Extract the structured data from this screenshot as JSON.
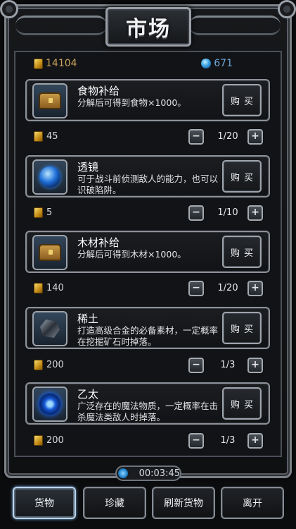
{
  "header": {
    "title": "市场"
  },
  "currency": {
    "gold": "14104",
    "gems": "671"
  },
  "items": [
    {
      "name": "食物补给",
      "desc": "分解后可得到食物×1000。",
      "icon": "treasure-chest-icon",
      "price": "45",
      "qty": "1/20",
      "buy_label": "购买"
    },
    {
      "name": "透镜",
      "desc": "可于战斗前侦测敌人的能力，也可以识破陷阱。",
      "icon": "blue-lens-orb-icon",
      "price": "5",
      "qty": "1/10",
      "buy_label": "购买"
    },
    {
      "name": "木材补给",
      "desc": "分解后可得到木材×1000。",
      "icon": "treasure-chest-icon",
      "price": "140",
      "qty": "1/20",
      "buy_label": "购买"
    },
    {
      "name": "稀土",
      "desc": "打造高级合金的必备素材，一定概率在挖掘矿石时掉落。",
      "icon": "dark-ore-icon",
      "price": "200",
      "qty": "1/3",
      "buy_label": "购买"
    },
    {
      "name": "乙太",
      "desc": "广泛存在的魔法物质，一定概率在击杀魔法类敌人时掉落。",
      "icon": "ether-orb-icon",
      "price": "200",
      "qty": "1/3",
      "buy_label": "购买"
    }
  ],
  "controls": {
    "minus": "−",
    "plus": "+"
  },
  "timer": {
    "value": "00:03:45"
  },
  "tabs": [
    {
      "label": "货物",
      "active": true
    },
    {
      "label": "珍藏",
      "active": false
    },
    {
      "label": "刷新货物",
      "active": false
    },
    {
      "label": "离开",
      "active": false
    }
  ]
}
